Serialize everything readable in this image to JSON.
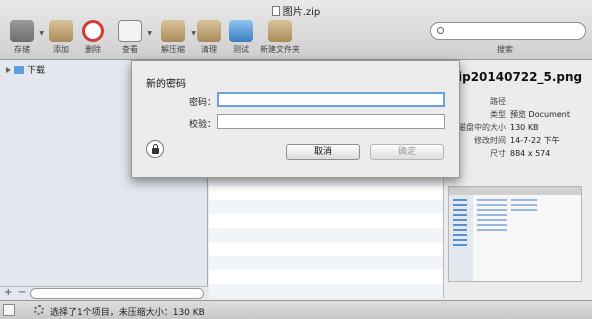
{
  "window": {
    "title": "图片.zip"
  },
  "toolbar": {
    "items": [
      {
        "label": "存储",
        "icon": "disk-icon",
        "color": "#7a7a7a"
      },
      {
        "label": "添加",
        "icon": "add-box-icon",
        "color": "#b89a6a"
      },
      {
        "label": "删除",
        "icon": "no-entry-icon",
        "color": "#d33b3b"
      },
      {
        "label": "查看",
        "icon": "magnifier-icon",
        "color": "#9c9c9c"
      },
      {
        "label": "解压缩",
        "icon": "extract-box-icon",
        "color": "#b89a6a"
      },
      {
        "label": "清理",
        "icon": "clean-box-icon",
        "color": "#b89a6a"
      },
      {
        "label": "测试",
        "icon": "test-monitor-icon",
        "color": "#4a8fd0"
      },
      {
        "label": "新建文件夹",
        "icon": "new-folder-icon",
        "color": "#b89a6a"
      }
    ],
    "search_label": "搜索"
  },
  "sidebar": {
    "items": [
      {
        "label": "下载",
        "icon": "folder-icon"
      }
    ]
  },
  "preview": {
    "filename": "ip20140722_5.png",
    "info": [
      {
        "key": "路径",
        "value": ""
      },
      {
        "key": "类型",
        "value": "预览 Document"
      },
      {
        "key": "磁盘中的大小",
        "value": "130 KB"
      },
      {
        "key": "修改时间",
        "value": "14-7-22 下午"
      },
      {
        "key": "尺寸",
        "value": "884 x 574"
      }
    ]
  },
  "status": {
    "text": "选择了1个项目，未压缩大小：130 KB"
  },
  "dialog": {
    "title": "新的密码",
    "password_label": "密码：",
    "verify_label": "校验：",
    "password_value": "",
    "verify_value": "",
    "cancel_label": "取消",
    "ok_label": "确定"
  },
  "colors": {
    "accent": "#6aa0e0",
    "stripe": "#f1f4f9"
  }
}
